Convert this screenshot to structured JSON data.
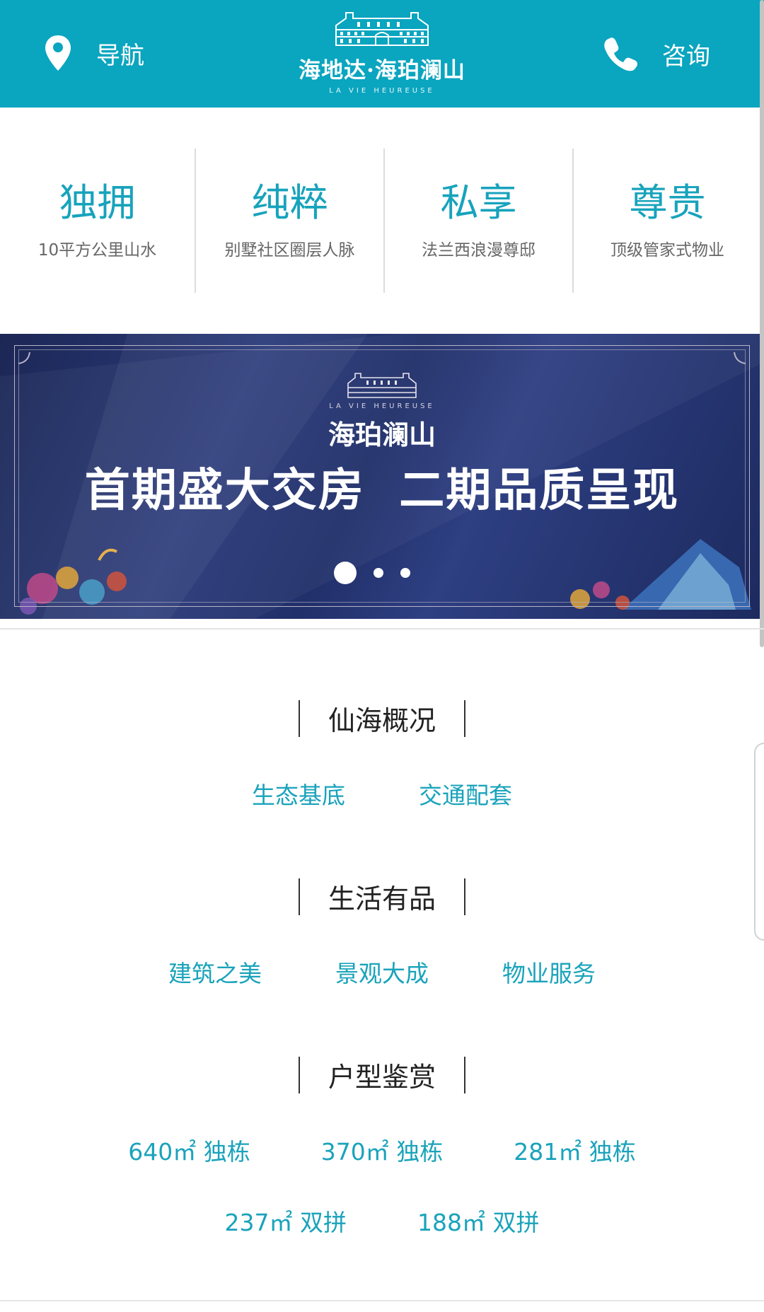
{
  "header": {
    "nav_label": "导航",
    "consult_label": "咨询",
    "logo_cn": "海地达·海珀澜山",
    "logo_en": "LA VIE HEUREUSE",
    "bg_color": "#0aa5bf"
  },
  "features": [
    {
      "title": "独拥",
      "subtitle": "10平方公里山水"
    },
    {
      "title": "纯粹",
      "subtitle": "别墅社区圈层人脉"
    },
    {
      "title": "私享",
      "subtitle": "法兰西浪漫尊邸"
    },
    {
      "title": "尊贵",
      "subtitle": "顶级管家式物业"
    }
  ],
  "banner": {
    "en": "LA VIE HEUREUSE",
    "name": "海珀澜山",
    "headline": "首期盛大交房  二期品质呈现",
    "slides": 3,
    "active_slide": 1
  },
  "sections": [
    {
      "title": "仙海概况",
      "links": [
        "生态基底",
        "交通配套"
      ]
    },
    {
      "title": "生活有品",
      "links": [
        "建筑之美",
        "景观大成",
        "物业服务"
      ]
    },
    {
      "title": "户型鉴赏",
      "links_row1": [
        "640㎡ 独栋",
        "370㎡ 独栋",
        "281㎡ 独栋"
      ],
      "links_row2": [
        "237㎡ 双拼",
        "188㎡ 双拼"
      ]
    }
  ],
  "accent_color": "#1aa3bb"
}
